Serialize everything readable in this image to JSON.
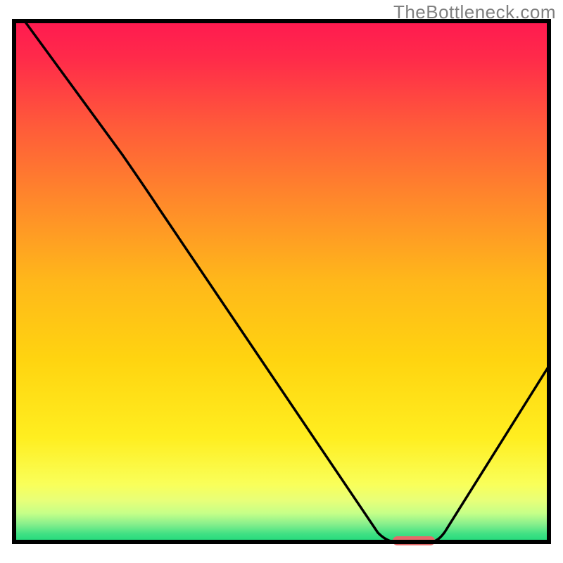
{
  "watermark": "TheBottleneck.com",
  "chart_data": {
    "type": "line",
    "title": "",
    "xlabel": "",
    "ylabel": "",
    "x_range": [
      0,
      100
    ],
    "y_range": [
      0,
      100
    ],
    "curve": [
      {
        "x": 2,
        "y": 100
      },
      {
        "x": 20,
        "y": 75
      },
      {
        "x": 27,
        "y": 68
      },
      {
        "x": 68,
        "y": 2
      },
      {
        "x": 72,
        "y": 0
      },
      {
        "x": 78,
        "y": 0
      },
      {
        "x": 100,
        "y": 33
      }
    ],
    "optimum_band": {
      "x_start": 72,
      "x_end": 78,
      "y": 0
    },
    "background": {
      "top_color": "#ff1a4d",
      "mid_color": "#ffd400",
      "low_color": "#f6ff66",
      "bottom_color": "#1fd97a"
    },
    "frame_color": "#000000",
    "curve_color": "#000000",
    "optimum_color": "#e46a6a"
  }
}
